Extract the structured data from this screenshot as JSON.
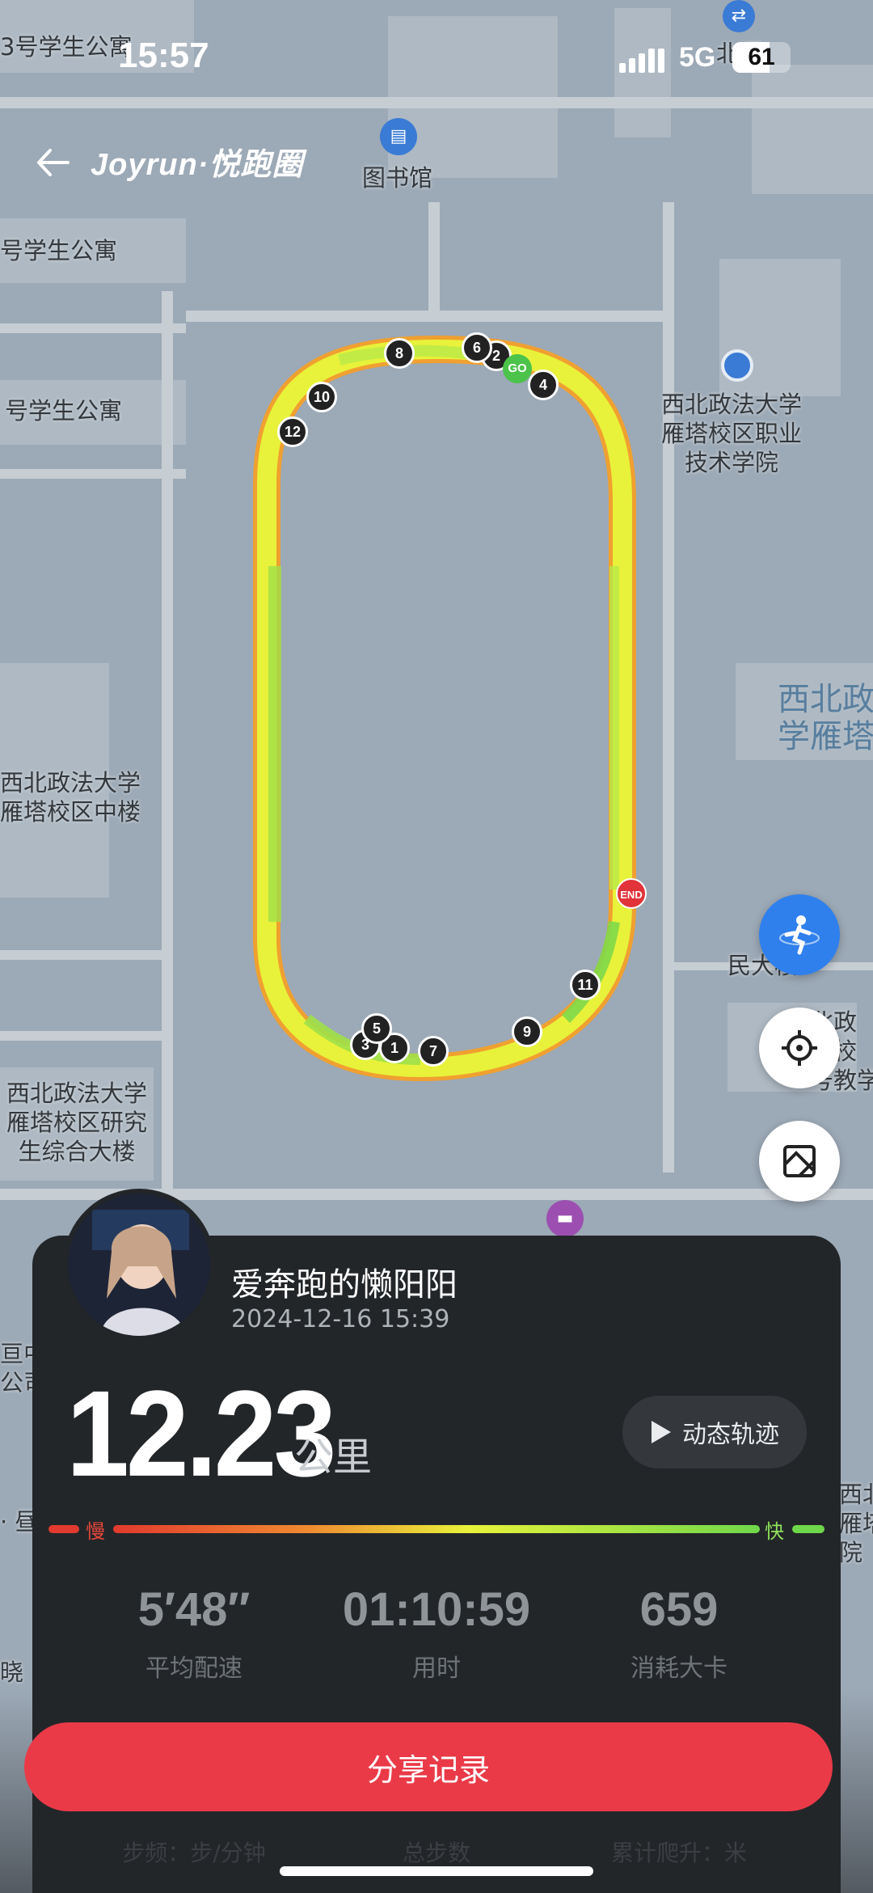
{
  "status_bar": {
    "time": "15:57",
    "network": "5G",
    "battery": "61"
  },
  "header": {
    "brand": "Joyrun·悦跑圈"
  },
  "map": {
    "labels": {
      "dorm3": "3号学生公寓",
      "dorm_a": "号学生公寓",
      "dorm_b": "号学生公寓",
      "library": "图书馆",
      "north_gate": "北门",
      "vocational": "西北政法大学\n雁塔校区职业\n技术学院",
      "middle_building": "西北政法大学\n雁塔校区中楼",
      "graduate_building": "西北政法大学\n雁塔校区研究\n生综合大楼",
      "right_big": "西北政\n学雁塔",
      "right_small": "民大楼",
      "right_small2": "北政\n塔校\n号教学",
      "left_cut": "亘中\n公司",
      "left_cut2": "· 昼",
      "left_cut3": "晓",
      "right_cut": "西北\n雁塔\n院"
    },
    "route_markers": [
      "1",
      "2",
      "3",
      "4",
      "5",
      "6",
      "7",
      "8",
      "9",
      "10",
      "11",
      "12"
    ],
    "start_label": "GO",
    "end_label": "END"
  },
  "profile": {
    "name": "爱奔跑的懒阳阳",
    "date": "2024-12-16 15:39"
  },
  "run": {
    "distance": "12.23",
    "distance_unit": "公里",
    "replay_label": "动态轨迹",
    "pace_slow": "慢",
    "pace_fast": "快",
    "stats": [
      {
        "value": "5′48″",
        "label": "平均配速"
      },
      {
        "value": "01:10:59",
        "label": "用时"
      },
      {
        "value": "659",
        "label": "消耗大卡"
      }
    ],
    "share_label": "分享记录",
    "more_stats": [
      "步频：步/分钟",
      "总步数",
      "累计爬升：米"
    ]
  },
  "colors": {
    "accent": "#ea3a48",
    "card": "#232629",
    "route_yellow": "#e8f23a",
    "route_green": "#9fe04a",
    "route_orange": "#f0a030"
  }
}
